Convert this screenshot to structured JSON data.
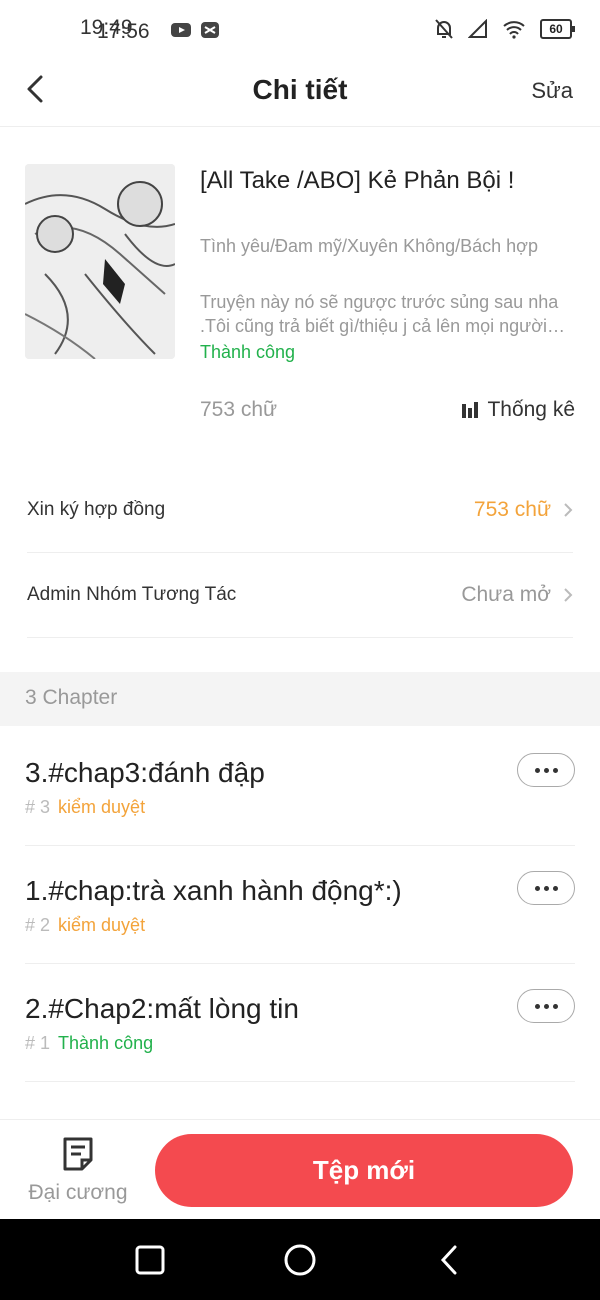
{
  "status_bar": {
    "time_a": "19:49",
    "time_b": "17:56",
    "battery": "60"
  },
  "header": {
    "title": "Chi tiết",
    "edit_label": "Sửa"
  },
  "book": {
    "title": "[All Take /ABO] Kẻ Phản Bội !",
    "genres": "Tình yêu/Đam mỹ/Xuyên Không/Bách hợp",
    "description": "Truyện này nó sẽ ngược trước sủng sau nha .Tôi cũng trả biết gì/thiệu j cả lên mọi người đọc rồi biết",
    "status": "Thành công",
    "word_count": "753 chữ",
    "stats_label": "Thống kê"
  },
  "rows": [
    {
      "label": "Xin ký hợp đồng",
      "value": "753 chữ",
      "color": "#f3a33a"
    },
    {
      "label": "Admin Nhóm Tương Tác",
      "value": "Chưa mở",
      "color": "#999999"
    }
  ],
  "section": {
    "label": "3 Chapter"
  },
  "chapters": [
    {
      "title": "3.#chap3:đánh đập",
      "number": "# 3",
      "status": "kiểm duyệt",
      "status_color": "#f3a33a"
    },
    {
      "title": "1.#chap:trà xanh hành động*:)",
      "number": "# 2",
      "status": "kiểm duyệt",
      "status_color": "#f3a33a"
    },
    {
      "title": "2.#Chap2:mất lòng tin",
      "number": "# 1",
      "status": "Thành công",
      "status_color": "#22b14c"
    }
  ],
  "bottom": {
    "outline_label": "Đại cương",
    "new_file_label": "Tệp mới"
  },
  "colors": {
    "accent": "#f44a4f",
    "success": "#22b14c",
    "warning": "#f3a33a"
  }
}
